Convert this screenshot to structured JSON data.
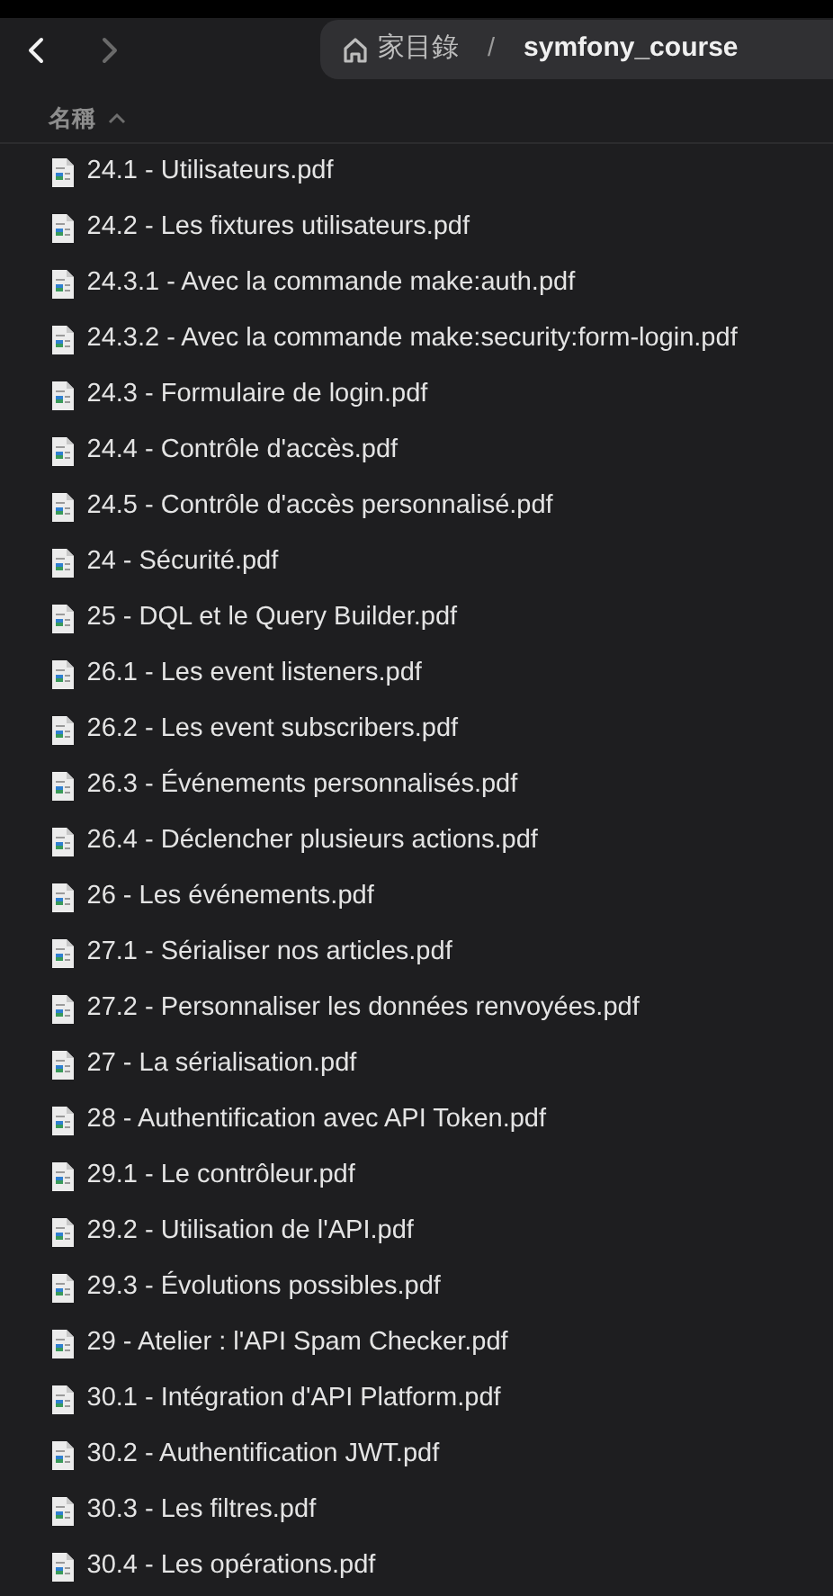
{
  "toolbar": {
    "back": {
      "disabled": false
    },
    "forward": {
      "disabled": true
    },
    "breadcrumb": [
      {
        "label": "家目錄",
        "kind": "home",
        "selected": false
      },
      {
        "label": "symfony_course",
        "kind": "folder",
        "selected": true
      }
    ],
    "separator": "/"
  },
  "column_header": {
    "label": "名稱",
    "sort_ascending": true
  },
  "files": [
    {
      "name": "24.1 - Utilisateurs.pdf"
    },
    {
      "name": "24.2 - Les fixtures utilisateurs.pdf"
    },
    {
      "name": "24.3.1 - Avec la commande make:auth.pdf"
    },
    {
      "name": "24.3.2 - Avec la commande make:security:form-login.pdf"
    },
    {
      "name": "24.3 - Formulaire de login.pdf"
    },
    {
      "name": "24.4 - Contrôle d'accès.pdf"
    },
    {
      "name": "24.5 - Contrôle d'accès personnalisé.pdf"
    },
    {
      "name": "24 - Sécurité.pdf"
    },
    {
      "name": "25 - DQL et le Query Builder.pdf"
    },
    {
      "name": "26.1 - Les event listeners.pdf"
    },
    {
      "name": "26.2 - Les event subscribers.pdf"
    },
    {
      "name": "26.3 - Événements personnalisés.pdf"
    },
    {
      "name": "26.4 - Déclencher plusieurs actions.pdf"
    },
    {
      "name": "26 - Les événements.pdf"
    },
    {
      "name": "27.1 - Sérialiser nos articles.pdf"
    },
    {
      "name": "27.2 - Personnaliser les données renvoyées.pdf"
    },
    {
      "name": "27 - La sérialisation.pdf"
    },
    {
      "name": "28 - Authentification avec API Token.pdf"
    },
    {
      "name": "29.1 - Le contrôleur.pdf"
    },
    {
      "name": "29.2 - Utilisation de l'API.pdf"
    },
    {
      "name": "29.3 - Évolutions possibles.pdf"
    },
    {
      "name": "29 - Atelier : l'API Spam Checker.pdf"
    },
    {
      "name": "30.1 - Intégration d'API Platform.pdf"
    },
    {
      "name": "30.2 - Authentification JWT.pdf"
    },
    {
      "name": "30.3 - Les filtres.pdf"
    },
    {
      "name": "30.4 - Les opérations.pdf"
    }
  ]
}
